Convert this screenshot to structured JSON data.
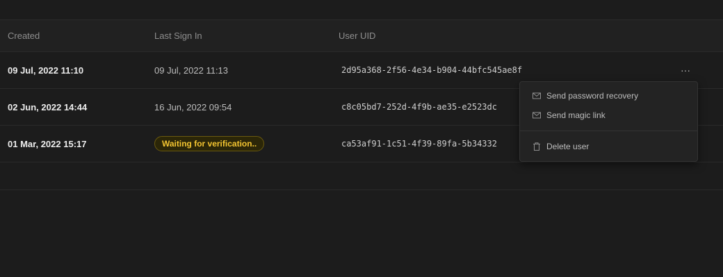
{
  "table": {
    "columns": {
      "created": "Created",
      "last_sign_in": "Last Sign In",
      "uid": "User UID"
    },
    "rows": [
      {
        "created": "09 Jul, 2022 11:10",
        "last_sign_in": "09 Jul, 2022 11:13",
        "uid": "2d95a368-2f56-4e34-b904-44bfc545ae8f"
      },
      {
        "created": "02 Jun, 2022 14:44",
        "last_sign_in": "16 Jun, 2022 09:54",
        "uid": "c8c05bd7-252d-4f9b-ae35-e2523dc"
      },
      {
        "created": "01 Mar, 2022 15:17",
        "status_badge": "Waiting for verification..",
        "uid": "ca53af91-1c51-4f39-89fa-5b34332"
      }
    ],
    "more_icon": "ellipsis-icon"
  },
  "menu": {
    "items": [
      {
        "label": "Send password recovery",
        "icon": "mail-icon"
      },
      {
        "label": "Send magic link",
        "icon": "mail-icon"
      },
      {
        "label": "Delete user",
        "icon": "trash-icon"
      }
    ]
  },
  "colors": {
    "background": "#1c1c1c",
    "badge_text": "#f4c531",
    "badge_border": "#6b5a0e"
  }
}
